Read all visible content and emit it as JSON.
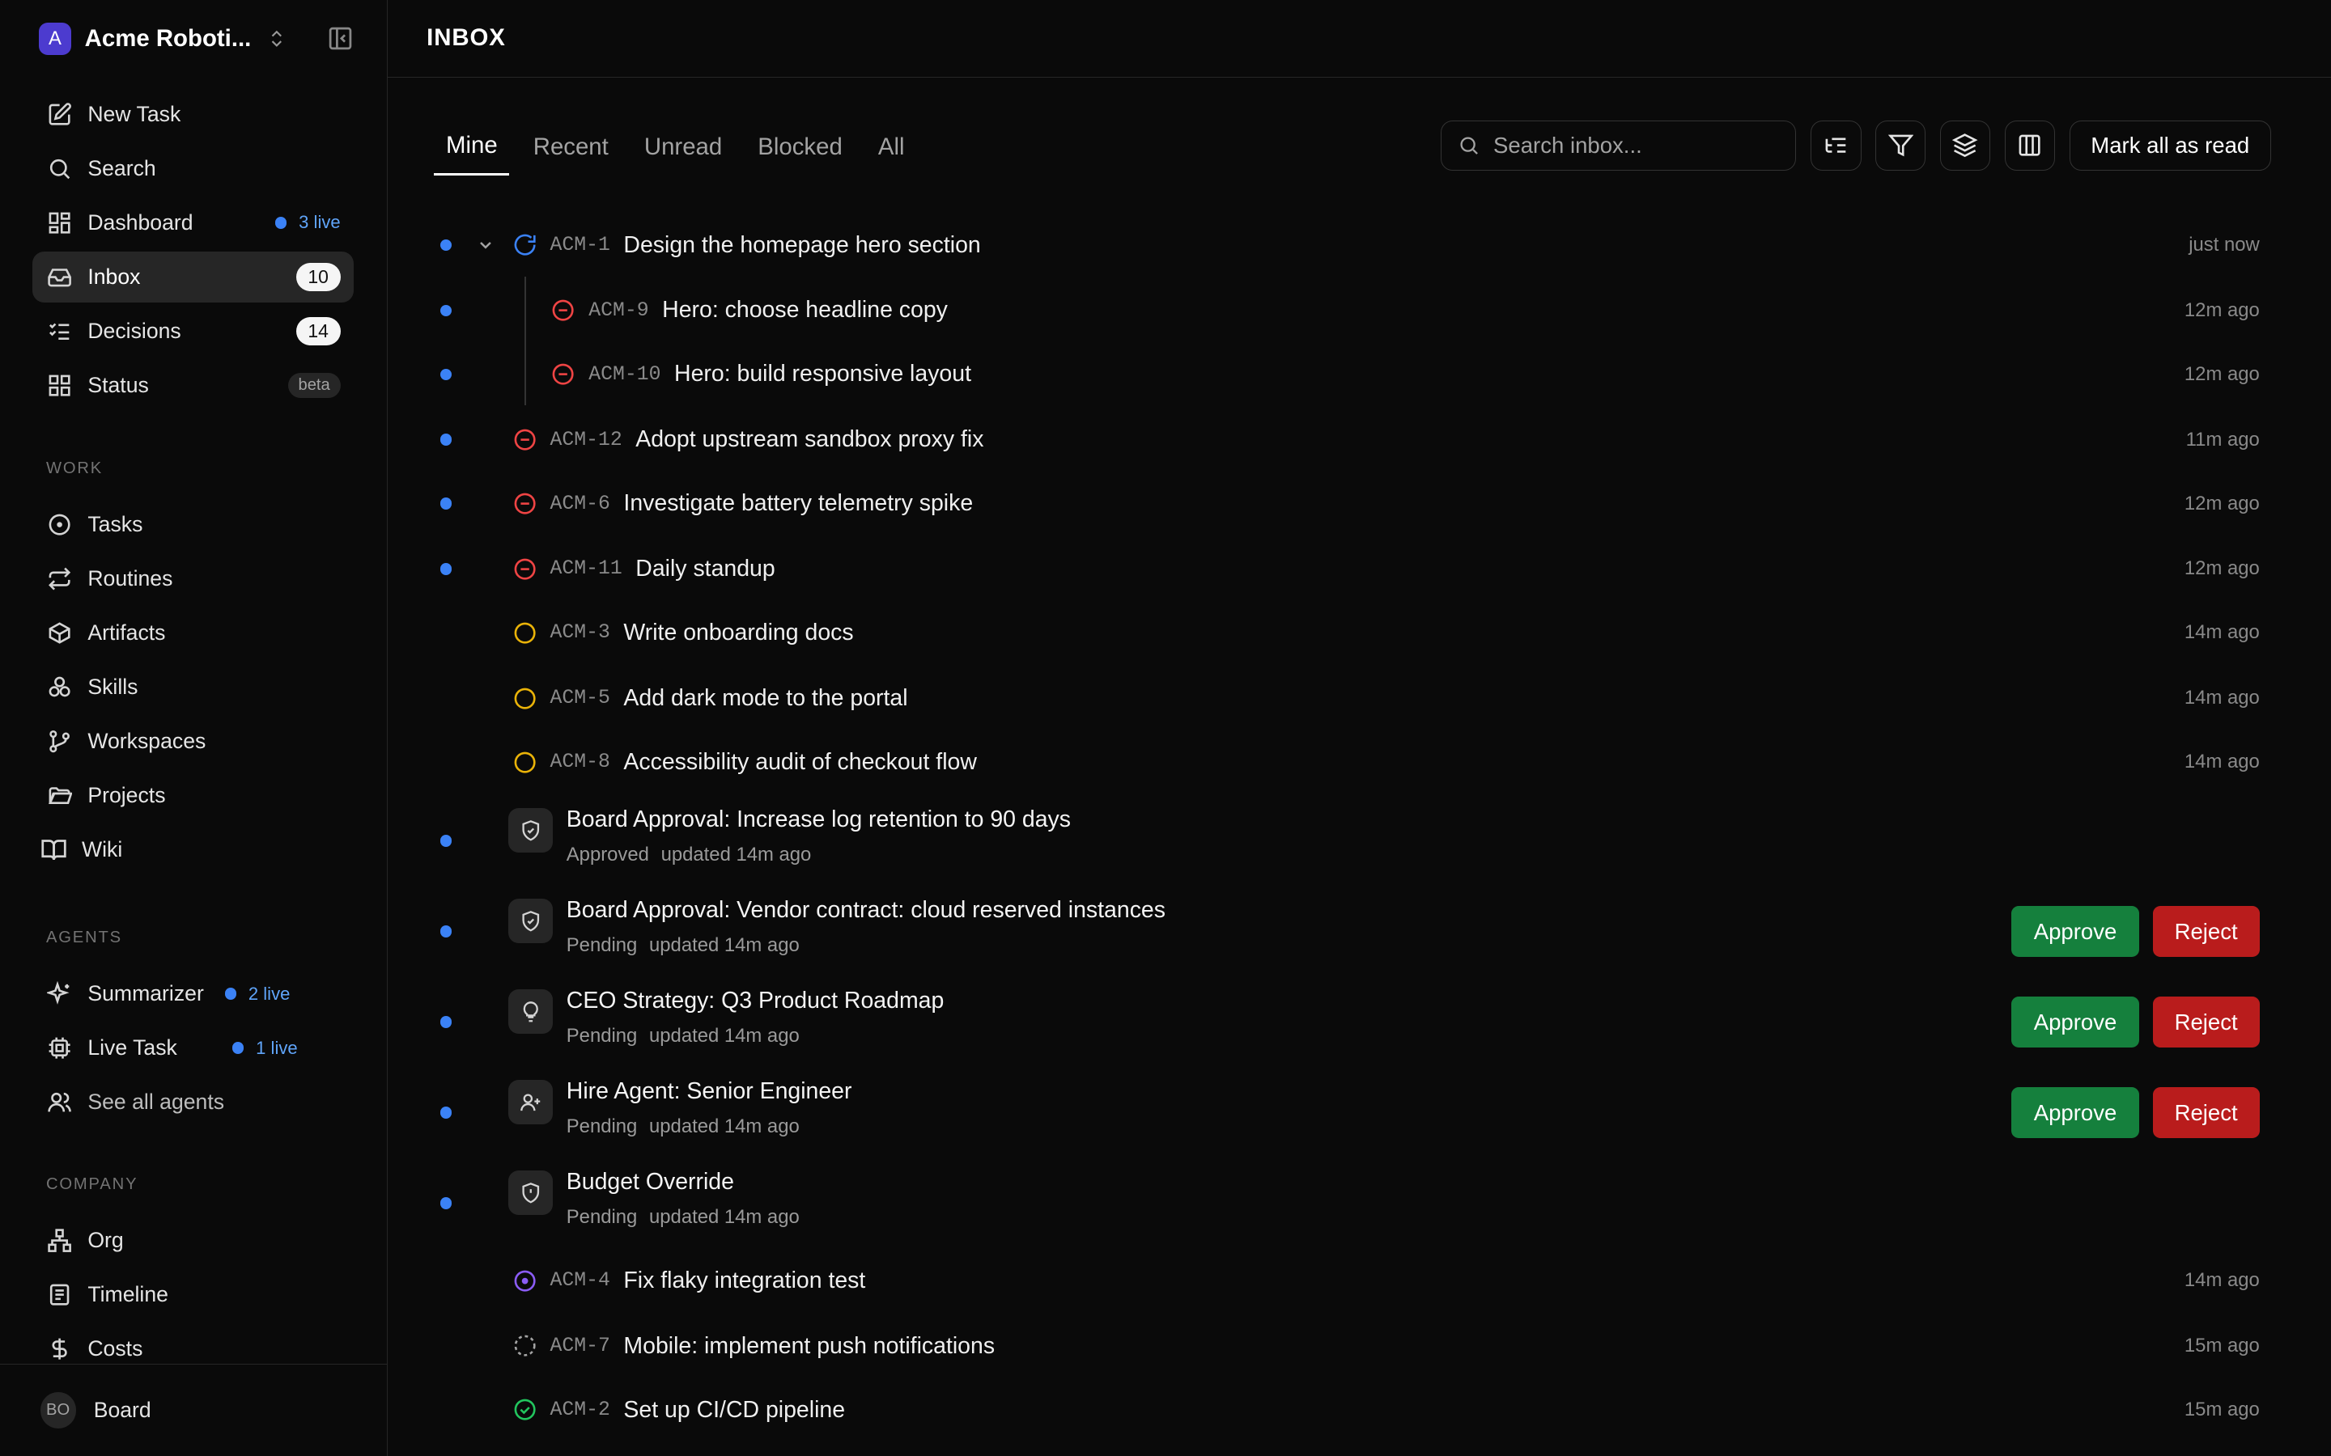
{
  "workspace": {
    "logo_letter": "A",
    "name": "Acme Roboti...",
    "accent": "#4c3bcf"
  },
  "nav": {
    "new_task": "New Task",
    "search": "Search",
    "dashboard": "Dashboard",
    "dashboard_live": "3 live",
    "inbox": "Inbox",
    "inbox_count": "10",
    "decisions": "Decisions",
    "decisions_count": "14",
    "status": "Status",
    "status_badge": "beta"
  },
  "work": {
    "label": "WORK",
    "tasks": "Tasks",
    "routines": "Routines",
    "artifacts": "Artifacts",
    "skills": "Skills",
    "workspaces": "Workspaces",
    "projects": "Projects",
    "wiki": "Wiki"
  },
  "agents": {
    "label": "AGENTS",
    "summarizer": "Summarizer",
    "summarizer_live": "2 live",
    "live_task": "Live Task",
    "live_task_live": "1 live",
    "see_all": "See all agents"
  },
  "company": {
    "label": "COMPANY",
    "org": "Org",
    "timeline": "Timeline",
    "costs": "Costs"
  },
  "user": {
    "initials": "BO",
    "name": "Board"
  },
  "header": {
    "title": "INBOX"
  },
  "tabs": {
    "mine": "Mine",
    "recent": "Recent",
    "unread": "Unread",
    "blocked": "Blocked",
    "all": "All"
  },
  "toolbar": {
    "search_placeholder": "Search inbox...",
    "mark_all": "Mark all as read"
  },
  "items": [
    {
      "id": "ACM-1",
      "title": "Design the homepage hero section",
      "time": "just now",
      "status": "in-progress",
      "unread": true
    },
    {
      "id": "ACM-9",
      "title": "Hero: choose headline copy",
      "time": "12m ago",
      "status": "blocked",
      "unread": true
    },
    {
      "id": "ACM-10",
      "title": "Hero: build responsive layout",
      "time": "12m ago",
      "status": "blocked",
      "unread": true
    },
    {
      "id": "ACM-12",
      "title": "Adopt upstream sandbox proxy fix",
      "time": "11m ago",
      "status": "blocked",
      "unread": true
    },
    {
      "id": "ACM-6",
      "title": "Investigate battery telemetry spike",
      "time": "12m ago",
      "status": "blocked",
      "unread": true
    },
    {
      "id": "ACM-11",
      "title": "Daily standup",
      "time": "12m ago",
      "status": "blocked",
      "unread": true
    },
    {
      "id": "ACM-3",
      "title": "Write onboarding docs",
      "time": "14m ago",
      "status": "todo",
      "unread": false
    },
    {
      "id": "ACM-5",
      "title": "Add dark mode to the portal",
      "time": "14m ago",
      "status": "todo",
      "unread": false
    },
    {
      "id": "ACM-8",
      "title": "Accessibility audit of checkout flow",
      "time": "14m ago",
      "status": "todo",
      "unread": false
    }
  ],
  "approvals": [
    {
      "title": "Board Approval: Increase log retention to 90 days",
      "state": "Approved",
      "updated": "updated 14m ago",
      "icon": "shield-check-icon"
    },
    {
      "title": "Board Approval: Vendor contract: cloud reserved instances",
      "state": "Pending",
      "updated": "updated 14m ago",
      "icon": "shield-check-icon"
    },
    {
      "title": "CEO Strategy: Q3 Product Roadmap",
      "state": "Pending",
      "updated": "updated 14m ago",
      "icon": "lightbulb-icon"
    },
    {
      "title": "Hire Agent: Senior Engineer",
      "state": "Pending",
      "updated": "updated 14m ago",
      "icon": "user-plus-icon"
    },
    {
      "title": "Budget Override",
      "state": "Pending",
      "updated": "updated 14m ago",
      "icon": "shield-alert-icon"
    }
  ],
  "actions": {
    "approve": "Approve",
    "reject": "Reject"
  },
  "items_tail": [
    {
      "id": "ACM-4",
      "title": "Fix flaky integration test",
      "time": "14m ago",
      "status": "in-review"
    },
    {
      "id": "ACM-7",
      "title": "Mobile: implement push notifications",
      "time": "15m ago",
      "status": "backlog"
    },
    {
      "id": "ACM-2",
      "title": "Set up CI/CD pipeline",
      "time": "15m ago",
      "status": "done"
    }
  ],
  "colors": {
    "unread_dot": "#3b82f6",
    "blocked": "#ef4444",
    "todo": "#eab308",
    "in_progress": "#3b82f6",
    "in_review": "#8b5cf6",
    "done": "#22c55e",
    "approve": "#15803d",
    "reject": "#b91c1c"
  }
}
